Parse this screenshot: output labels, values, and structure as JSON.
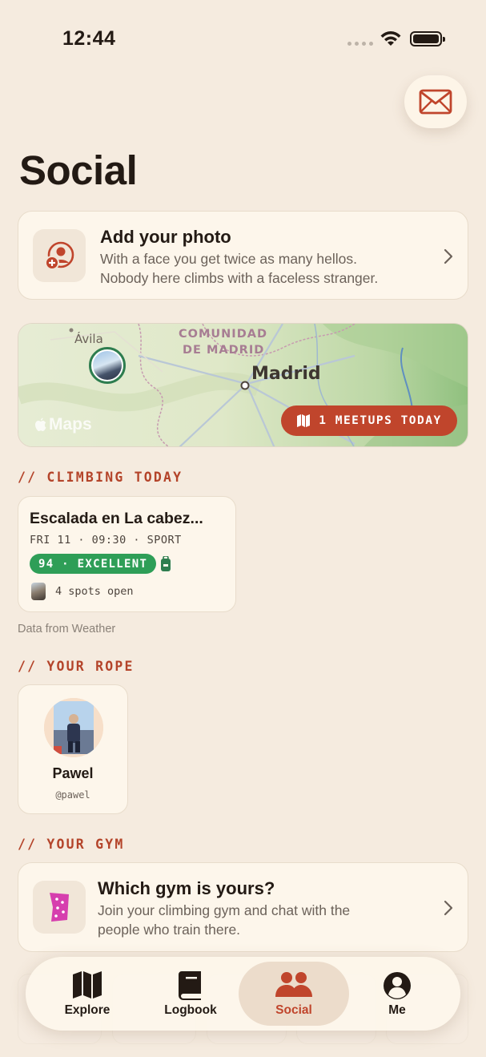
{
  "status_bar": {
    "time": "12:44"
  },
  "header": {
    "title": "Social",
    "mail_icon": "envelope-icon"
  },
  "photo_prompt": {
    "title": "Add your photo",
    "subtitle_line1": "With a face you get twice as many hellos.",
    "subtitle_line2": "Nobody here climbs with a faceless stranger."
  },
  "map": {
    "label_avila": "Ávila",
    "label_region_1": "COMUNIDAD",
    "label_region_2": "DE MADRID",
    "label_city": "Madrid",
    "brand": "Maps",
    "meetups_label": "1 MEETUPS TODAY"
  },
  "climbing_today": {
    "header": "// CLIMBING TODAY",
    "card": {
      "title": "Escalada en La cabez...",
      "meta": "FRI 11 · 09:30 · SPORT",
      "score": "94 · EXCELLENT",
      "spots": "4 spots open"
    },
    "weather_credit": "Data from  Weather"
  },
  "rope": {
    "header": "// YOUR ROPE",
    "member": {
      "name": "Pawel",
      "handle": "@pawel"
    }
  },
  "gym": {
    "header": "// YOUR GYM",
    "title": "Which gym is yours?",
    "subtitle_line1": "Join your climbing gym and chat with the",
    "subtitle_line2": "people who train there."
  },
  "tab_bar": {
    "tabs": [
      {
        "label": "Explore",
        "icon": "map-icon"
      },
      {
        "label": "Logbook",
        "icon": "book-icon"
      },
      {
        "label": "Social",
        "icon": "people-icon",
        "active": true
      },
      {
        "label": "Me",
        "icon": "person-circle-icon"
      }
    ]
  },
  "colors": {
    "background": "#f5ebdf",
    "accent": "#c0452c",
    "score_green": "#2e9e57",
    "section_header": "#b4442a"
  }
}
